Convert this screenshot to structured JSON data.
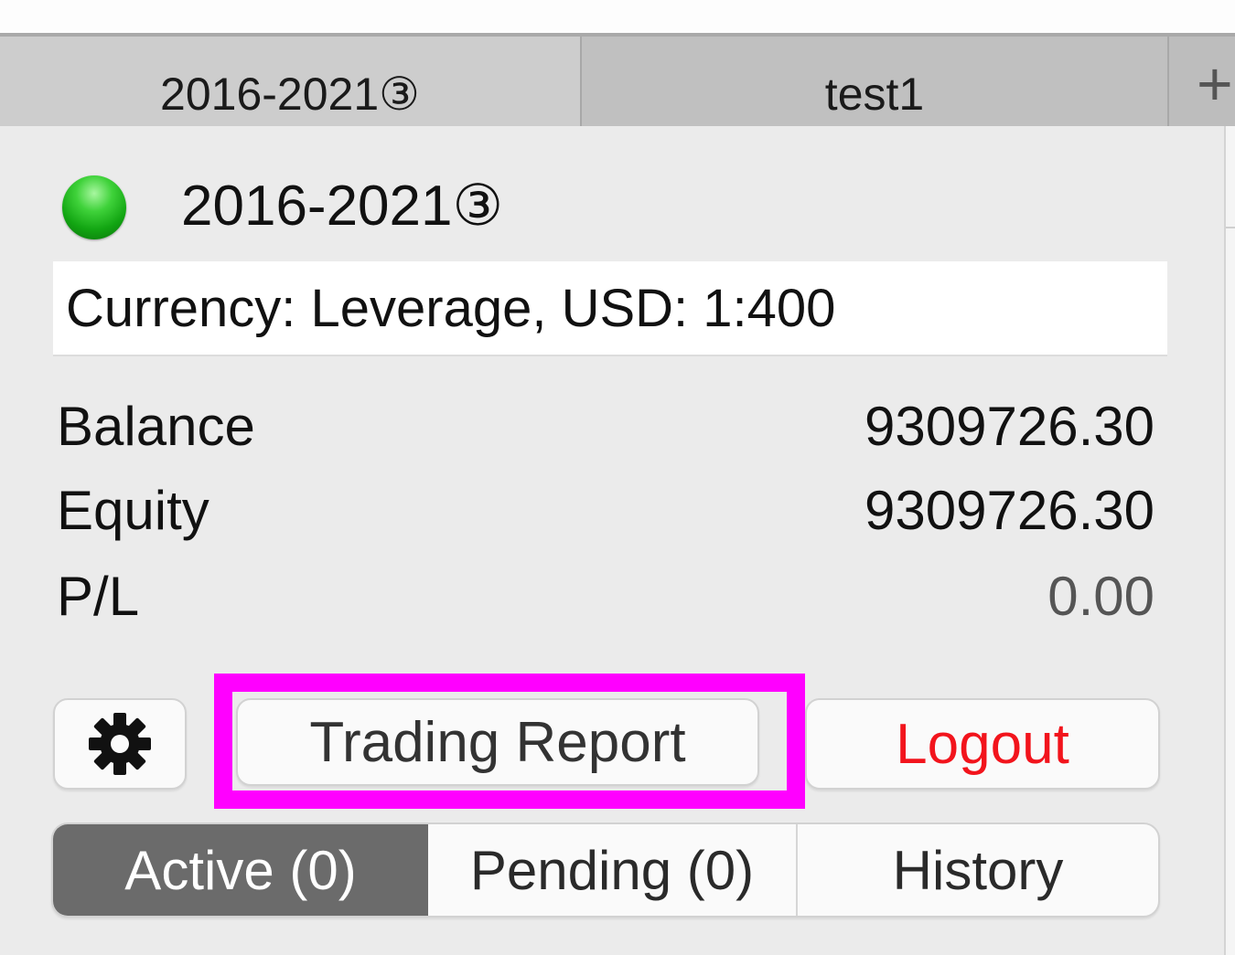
{
  "tabs": [
    {
      "label": "2016-2021③"
    },
    {
      "label": "test1"
    }
  ],
  "add_tab_symbol": "+",
  "account": {
    "status_color": "#2ecc2e",
    "title": "2016-2021③",
    "info": "Currency: Leverage, USD: 1:400"
  },
  "stats": {
    "balance_label": "Balance",
    "balance_value": "9309726.30",
    "equity_label": "Equity",
    "equity_value": "9309726.30",
    "pl_label": "P/L",
    "pl_value": "0.00"
  },
  "buttons": {
    "settings_icon": "gear-icon",
    "report_label": "Trading Report",
    "logout_label": "Logout",
    "logout_color": "#f2141c"
  },
  "highlight_color": "#ff00ff",
  "segments": {
    "active": "Active (0)",
    "pending": "Pending (0)",
    "history": "History",
    "selected": "active"
  }
}
